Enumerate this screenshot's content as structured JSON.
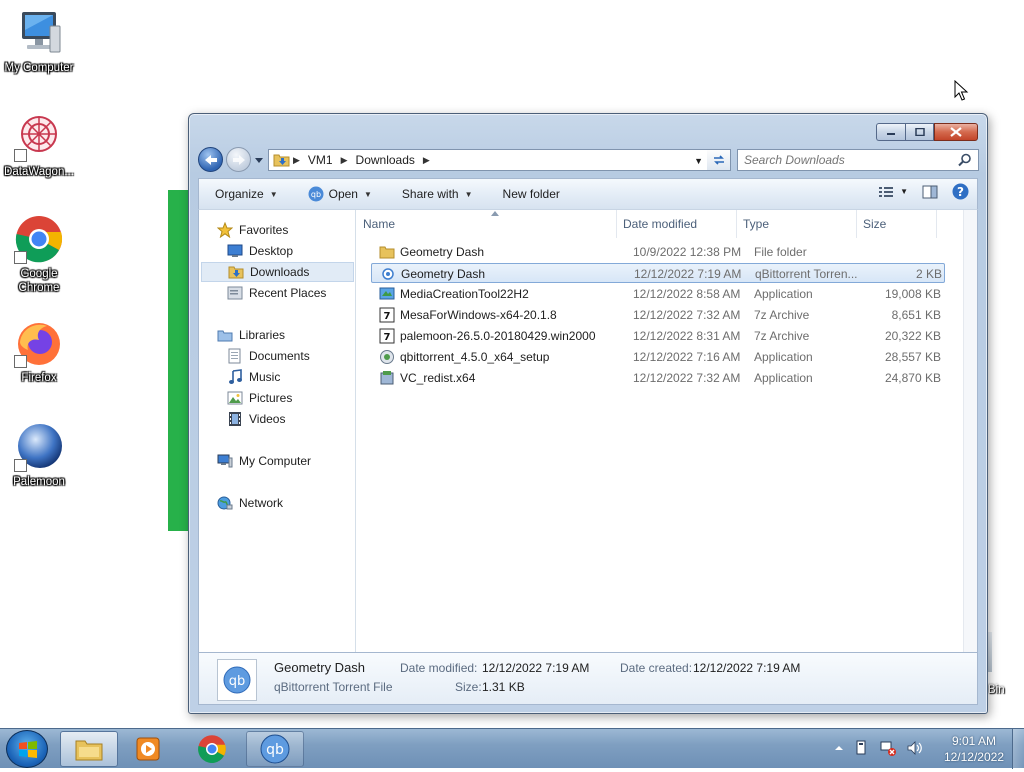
{
  "desktop": {
    "icons": [
      {
        "label": "My Computer"
      },
      {
        "label": "DataWagon..."
      },
      {
        "label": "Google Chrome"
      },
      {
        "label": "Firefox"
      },
      {
        "label": "Palemoon"
      }
    ],
    "recycle_bin_label": "Bin"
  },
  "window": {
    "address": {
      "crumbs": [
        "VM1",
        "Downloads"
      ]
    },
    "search": {
      "placeholder": "Search Downloads"
    },
    "toolbar": {
      "organize": "Organize",
      "open": "Open",
      "share_with": "Share with",
      "new_folder": "New folder"
    },
    "nav": {
      "favorites": "Favorites",
      "desktop": "Desktop",
      "downloads": "Downloads",
      "recent_places": "Recent Places",
      "libraries": "Libraries",
      "documents": "Documents",
      "music": "Music",
      "pictures": "Pictures",
      "videos": "Videos",
      "my_computer": "My Computer",
      "network": "Network"
    },
    "columns": {
      "name": "Name",
      "date": "Date modified",
      "type": "Type",
      "size": "Size"
    },
    "files": [
      {
        "name": "Geometry Dash",
        "date": "10/9/2022 12:38 PM",
        "type": "File folder",
        "size": "",
        "icon": "folder-icon"
      },
      {
        "name": "Geometry Dash",
        "date": "12/12/2022 7:19 AM",
        "type": "qBittorrent Torren...",
        "size": "2 KB",
        "icon": "torrent-file-icon"
      },
      {
        "name": "MediaCreationTool22H2",
        "date": "12/12/2022 8:58 AM",
        "type": "Application",
        "size": "19,008 KB",
        "icon": "app-icon"
      },
      {
        "name": "MesaForWindows-x64-20.1.8",
        "date": "12/12/2022 7:32 AM",
        "type": "7z Archive",
        "size": "8,651 KB",
        "icon": "archive-icon"
      },
      {
        "name": "palemoon-26.5.0-20180429.win2000",
        "date": "12/12/2022 8:31 AM",
        "type": "7z Archive",
        "size": "20,322 KB",
        "icon": "archive-icon"
      },
      {
        "name": "qbittorrent_4.5.0_x64_setup",
        "date": "12/12/2022 7:16 AM",
        "type": "Application",
        "size": "28,557 KB",
        "icon": "setup-icon"
      },
      {
        "name": "VC_redist.x64",
        "date": "12/12/2022 7:32 AM",
        "type": "Application",
        "size": "24,870 KB",
        "icon": "setup-icon"
      }
    ],
    "details": {
      "name": "Geometry Dash",
      "type": "qBittorrent Torrent File",
      "date_modified_label": "Date modified:",
      "date_modified": "12/12/2022 7:19 AM",
      "date_created_label": "Date created:",
      "date_created": "12/12/2022 7:19 AM",
      "size_label": "Size:",
      "size": "1.31 KB",
      "thumb_text": "qb"
    }
  },
  "taskbar": {
    "qb_text": "qb",
    "clock": {
      "time": "9:01 AM",
      "date": "12/12/2022"
    }
  },
  "colors": {
    "accent_green": "#27b14a",
    "selection": "#d7e6f7",
    "taskbar": "#7f9fc1"
  }
}
